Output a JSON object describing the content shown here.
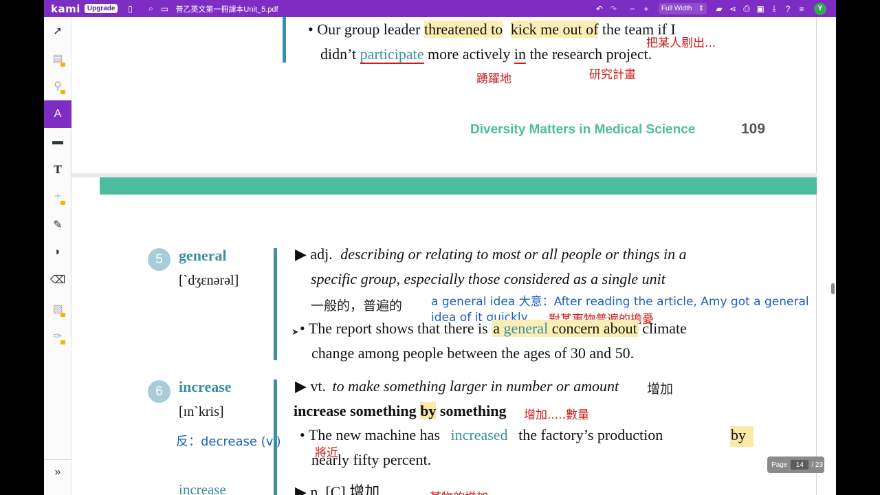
{
  "app": {
    "logo": "kami",
    "upgrade_label": "Upgrade",
    "filename": "普乙英文第一冊課本Unit_5.pdf",
    "zoom_label": "Full Width",
    "user_initial": "Y",
    "accent": "#7d2cc4"
  },
  "toolbar": {
    "left_icons": [
      "sidebar-icon",
      "search-icon",
      "file-icon"
    ],
    "right_icons": [
      "undo-icon",
      "redo-icon",
      "zoom-out-icon",
      "zoom-in-icon",
      "folder-icon",
      "share-icon",
      "print-icon",
      "save-icon",
      "download-icon",
      "help-icon",
      "menu-icon"
    ]
  },
  "tools": [
    "select-icon",
    "dictionary-icon",
    "tts-icon",
    "markup-icon",
    "comment-icon",
    "text-icon",
    "equation-icon",
    "drawing-icon",
    "shapes-icon",
    "eraser-icon",
    "image-icon",
    "signature-icon"
  ],
  "subtools": [
    "highlight-icon",
    "highlight-alt-icon",
    "edit-box-icon",
    "strikethrough-icon",
    "underline-icon"
  ],
  "colors": {
    "yellow_orange": "#f5c400",
    "red": "#e0101a",
    "yellow": "#f2ef18"
  },
  "page_top": {
    "line1_a": "• Our group leader",
    "line1_hl1": "threatened to",
    "line1_hl2": "kick me out of",
    "line1_b": "the team if I",
    "line2_a": "didn’t",
    "line2_participate": "participate",
    "line2_b": "more actively",
    "line2_in": "in",
    "line2_c": "the research project.",
    "note_kick": "把某人剔出...",
    "note_active": "踴躍地",
    "note_research": "研究計畫",
    "footer_title": "Diversity Matters in Medical Science",
    "footer_page": "109"
  },
  "entry5": {
    "number": "5",
    "word": "general",
    "pron": "[`dʒɛnərəl]",
    "pos": "▶ adj.",
    "def1": "describing or relating to most or all people or things in a",
    "def2": "specific group, especially those considered as a single unit",
    "zh": "一般的，普遍的",
    "note_blue1": "a general idea 大意：After reading the article, Amy got a general",
    "note_blue2": "idea of it quickly.",
    "note_red": "對某事物普遍的擔憂",
    "ex_a": "• The report shows that there is",
    "ex_hl_a": "a",
    "ex_hl_general": "general",
    "ex_hl_b": "concern about",
    "ex_b": "climate",
    "ex_line2": "change among people between the ages of 30 and 50."
  },
  "entry6": {
    "number": "6",
    "word": "increase",
    "pron": "[ɪn`kris]",
    "antonym": "反：decrease (v.)",
    "pos": "▶ vt.",
    "def": "to make something larger in number or amount",
    "zh": "增加",
    "phrase_a": "increase something",
    "phrase_by": "by",
    "phrase_b": "something",
    "note_phrase": "增加.....數量",
    "ex_a": "• The new machine has",
    "ex_increased": "increased",
    "ex_b": "the factory’s production",
    "ex_by": "by",
    "note_nearly": "將近",
    "ex_line2": "nearly fifty percent.",
    "noun_word": "increase",
    "noun_pos": "▶ n. [C] 增加",
    "note_bottom": "某物的增加"
  },
  "pagination": {
    "label": "Page",
    "current": "14",
    "total": "/ 23"
  }
}
